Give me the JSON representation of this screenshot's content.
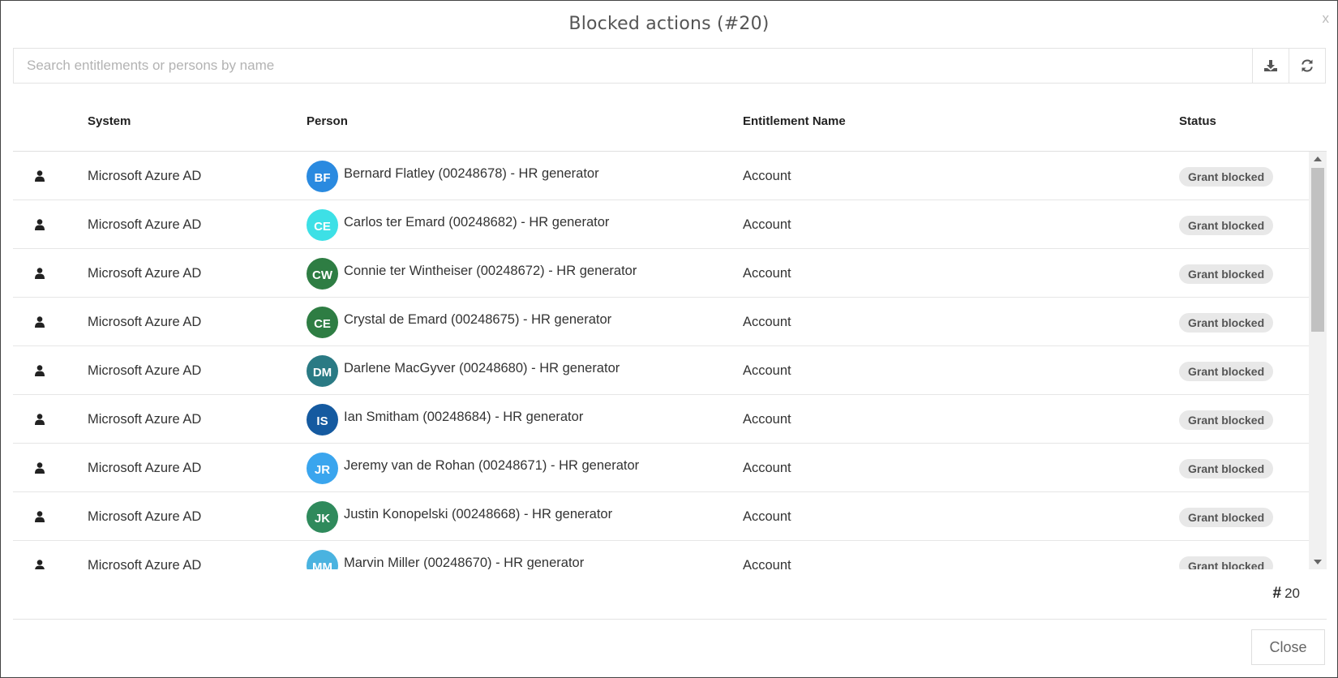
{
  "dialog": {
    "title": "Blocked actions (#20)",
    "close_x": "x",
    "close_button": "Close"
  },
  "search": {
    "placeholder": "Search entitlements or persons by name",
    "value": "",
    "download_icon": "download-icon",
    "refresh_icon": "refresh-icon"
  },
  "table": {
    "headers": {
      "system": "System",
      "person": "Person",
      "entitlement": "Entitlement Name",
      "status": "Status"
    },
    "rows": [
      {
        "system": "Microsoft Azure AD",
        "initials": "BF",
        "avatar_color": "#2a8ae0",
        "person": "Bernard Flatley (00248678) - HR generator",
        "entitlement": "Account",
        "status": "Grant blocked"
      },
      {
        "system": "Microsoft Azure AD",
        "initials": "CE",
        "avatar_color": "#3de0e6",
        "person": "Carlos ter Emard (00248682) - HR generator",
        "entitlement": "Account",
        "status": "Grant blocked"
      },
      {
        "system": "Microsoft Azure AD",
        "initials": "CW",
        "avatar_color": "#2e7d43",
        "person": "Connie ter Wintheiser (00248672) - HR generator",
        "entitlement": "Account",
        "status": "Grant blocked"
      },
      {
        "system": "Microsoft Azure AD",
        "initials": "CE",
        "avatar_color": "#2e7d43",
        "person": "Crystal de Emard (00248675) - HR generator",
        "entitlement": "Account",
        "status": "Grant blocked"
      },
      {
        "system": "Microsoft Azure AD",
        "initials": "DM",
        "avatar_color": "#2a7a84",
        "person": "Darlene MacGyver (00248680) - HR generator",
        "entitlement": "Account",
        "status": "Grant blocked"
      },
      {
        "system": "Microsoft Azure AD",
        "initials": "IS",
        "avatar_color": "#155aa0",
        "person": "Ian Smitham (00248684) - HR generator",
        "entitlement": "Account",
        "status": "Grant blocked"
      },
      {
        "system": "Microsoft Azure AD",
        "initials": "JR",
        "avatar_color": "#3aa5ee",
        "person": "Jeremy van de Rohan (00248671) - HR generator",
        "entitlement": "Account",
        "status": "Grant blocked"
      },
      {
        "system": "Microsoft Azure AD",
        "initials": "JK",
        "avatar_color": "#2f8a5c",
        "person": "Justin Konopelski (00248668) - HR generator",
        "entitlement": "Account",
        "status": "Grant blocked"
      },
      {
        "system": "Microsoft Azure AD",
        "initials": "MM",
        "avatar_color": "#4ab3e0",
        "person": "Marvin Miller (00248670) - HR generator",
        "entitlement": "Account",
        "status": "Grant blocked"
      }
    ]
  },
  "footer": {
    "count_icon": "hash-icon",
    "count": "20"
  },
  "colors": {
    "badge_bg": "#e8e8e8",
    "scroll_thumb": "#c1c1c1"
  }
}
